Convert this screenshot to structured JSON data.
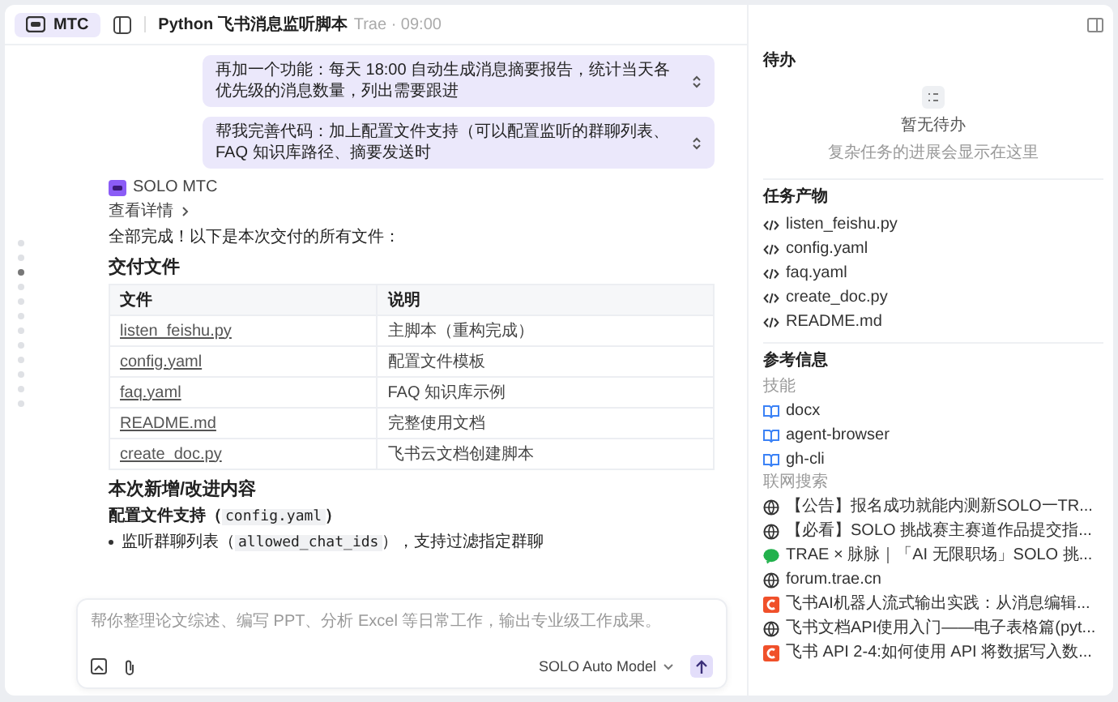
{
  "header": {
    "badge": "MTC",
    "title": "Python 飞书消息监听脚本",
    "meta": "Trae · 09:00"
  },
  "nav_dots": [
    {
      "selected": false
    },
    {
      "selected": false
    },
    {
      "selected": true
    },
    {
      "selected": false
    },
    {
      "selected": false
    },
    {
      "selected": false
    },
    {
      "selected": false
    },
    {
      "selected": false
    },
    {
      "selected": false
    },
    {
      "selected": false
    },
    {
      "selected": false
    },
    {
      "selected": false
    }
  ],
  "messages": [
    {
      "text": "再加一个功能：每天 18:00 自动生成消息摘要报告，统计当天各优先级的消息数量，列出需要跟进"
    },
    {
      "text": "帮我完善代码：加上配置文件支持（可以配置监听的群聊列表、FAQ 知识库路径、摘要发送时"
    }
  ],
  "reply": {
    "agent": "SOLO MTC",
    "details_link": "查看详情",
    "intro": "全部完成！以下是本次交付的所有文件：",
    "heading": "交付文件",
    "table": {
      "columns": [
        "文件",
        "说明"
      ],
      "rows": [
        [
          "listen_feishu.py",
          "主脚本（重构完成）"
        ],
        [
          "config.yaml",
          "配置文件模板"
        ],
        [
          "faq.yaml",
          "FAQ 知识库示例"
        ],
        [
          "README.md",
          "完整使用文档"
        ],
        [
          "create_doc.py",
          "飞书云文档创建脚本"
        ]
      ]
    },
    "heading_2": "本次新增/改进内容",
    "subheading": {
      "before": "配置文件支持（",
      "code": "config.yaml",
      "after": "）"
    },
    "bullet": {
      "before": "监听群聊列表（",
      "code": "allowed_chat_ids",
      "after": "），支持过滤指定群聊"
    }
  },
  "composer": {
    "placeholder": "帮你整理论文综述、编写 PPT、分析 Excel 等日常工作，输出专业级工作成果。",
    "model": "SOLO Auto Model"
  },
  "sidebar": {
    "todo": {
      "title": "待办",
      "empty_title": "暂无待办",
      "empty_hint": "复杂任务的进展会显示在这里"
    },
    "artifacts": {
      "title": "任务产物",
      "items": [
        "listen_feishu.py",
        "config.yaml",
        "faq.yaml",
        "create_doc.py",
        "README.md"
      ]
    },
    "references": {
      "title": "参考信息",
      "skills_label": "技能",
      "skills": [
        "docx",
        "agent-browser",
        "gh-cli"
      ],
      "search_label": "联网搜索",
      "results": [
        {
          "kind": "globe",
          "text": "【公告】报名成功就能内测新SOLO一TR..."
        },
        {
          "kind": "globe",
          "text": "【必看】SOLO 挑战赛主赛道作品提交指..."
        },
        {
          "kind": "chat",
          "text": "TRAE × 脉脉｜「AI 无限职场」SOLO 挑..."
        },
        {
          "kind": "globe",
          "text": "forum.trae.cn"
        },
        {
          "kind": "c-logo",
          "text": "飞书AI机器人流式输出实践：从消息编辑..."
        },
        {
          "kind": "globe",
          "text": "飞书文档API使用入门——电子表格篇(pyt..."
        },
        {
          "kind": "c-logo",
          "text": "飞书 API 2-4:如何使用 API 将数据写入数..."
        }
      ]
    }
  }
}
